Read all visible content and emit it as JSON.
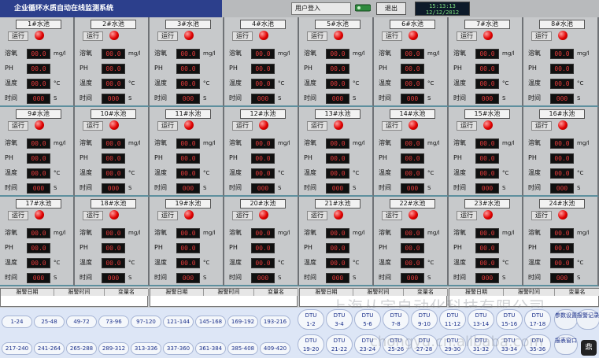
{
  "header": {
    "title": "企业循环水质自动在线监测系统",
    "login_label": "用户登入",
    "exit_label": "退出",
    "clock_time": "15:13:13",
    "clock_date": "12/12/2012"
  },
  "row_labels": {
    "run": "运行",
    "ammonia": "溶氧",
    "ph": "PH",
    "temp": "温度",
    "time": "时间",
    "unit_mgl": "mg/l",
    "unit_c": "°C",
    "unit_s": "S"
  },
  "panels": [
    {
      "title": "1#水池",
      "ammonia": "00.0",
      "ph": "00.0",
      "temp": "00.0",
      "time": "000"
    },
    {
      "title": "2#水池",
      "ammonia": "00.0",
      "ph": "00.0",
      "temp": "00.0",
      "time": "000"
    },
    {
      "title": "3#水池",
      "ammonia": "00.0",
      "ph": "00.0",
      "temp": "00.0",
      "time": "000"
    },
    {
      "title": "4#水池",
      "ammonia": "00.0",
      "ph": "00.0",
      "temp": "00.0",
      "time": "000"
    },
    {
      "title": "5#水池",
      "ammonia": "00.0",
      "ph": "00.0",
      "temp": "00.0",
      "time": "000"
    },
    {
      "title": "6#水池",
      "ammonia": "00.0",
      "ph": "00.0",
      "temp": "00.0",
      "time": "000"
    },
    {
      "title": "7#水池",
      "ammonia": "00.0",
      "ph": "00.0",
      "temp": "00.0",
      "time": "000"
    },
    {
      "title": "8#水池",
      "ammonia": "00.0",
      "ph": "00.0",
      "temp": "00.0",
      "time": "000"
    },
    {
      "title": "9#水池",
      "ammonia": "00.0",
      "ph": "00.0",
      "temp": "00.0",
      "time": "000"
    },
    {
      "title": "10#水池",
      "ammonia": "00.0",
      "ph": "00.0",
      "temp": "00.0",
      "time": "000"
    },
    {
      "title": "11#水池",
      "ammonia": "00.0",
      "ph": "00.0",
      "temp": "00.0",
      "time": "000"
    },
    {
      "title": "12#水池",
      "ammonia": "00.0",
      "ph": "00.0",
      "temp": "00.0",
      "time": "000"
    },
    {
      "title": "13#水池",
      "ammonia": "00.0",
      "ph": "00.0",
      "temp": "00.0",
      "time": "000"
    },
    {
      "title": "14#水池",
      "ammonia": "00.0",
      "ph": "00.0",
      "temp": "00.0",
      "time": "000"
    },
    {
      "title": "15#水池",
      "ammonia": "00.0",
      "ph": "00.0",
      "temp": "00.0",
      "time": "000"
    },
    {
      "title": "16#水池",
      "ammonia": "00.0",
      "ph": "00.0",
      "temp": "00.0",
      "time": "000"
    },
    {
      "title": "17#水池",
      "ammonia": "00.0",
      "ph": "00.0",
      "temp": "00.0",
      "time": "000"
    },
    {
      "title": "18#水池",
      "ammonia": "00.0",
      "ph": "00.0",
      "temp": "00.0",
      "time": "000"
    },
    {
      "title": "19#水池",
      "ammonia": "00.0",
      "ph": "00.0",
      "temp": "00.0",
      "time": "000"
    },
    {
      "title": "20#水池",
      "ammonia": "00.0",
      "ph": "00.0",
      "temp": "00.0",
      "time": "000"
    },
    {
      "title": "21#水池",
      "ammonia": "00.0",
      "ph": "00.0",
      "temp": "00.0",
      "time": "000"
    },
    {
      "title": "22#水池",
      "ammonia": "00.0",
      "ph": "00.0",
      "temp": "00.0",
      "time": "000"
    },
    {
      "title": "23#水池",
      "ammonia": "00.0",
      "ph": "00.0",
      "temp": "00.0",
      "time": "000"
    },
    {
      "title": "24#水池",
      "ammonia": "00.0",
      "ph": "00.0",
      "temp": "00.0",
      "time": "000"
    }
  ],
  "alarm_tables": [
    {
      "date": "报警日期",
      "time": "报警时间",
      "var": "变量名"
    },
    {
      "date": "报警日期",
      "time": "报警时间",
      "var": "变量名"
    },
    {
      "date": "报警日期",
      "time": "报警时间",
      "var": "变量名"
    },
    {
      "date": "报警日期",
      "time": "报警时间",
      "var": "变量名"
    }
  ],
  "ranges_top": [
    "1-24",
    "25-48",
    "49-72",
    "73-96",
    "97-120",
    "121-144",
    "145-168",
    "169-192",
    "193-216"
  ],
  "ranges_bottom": [
    "217-240",
    "241-264",
    "265-288",
    "289-312",
    "313-336",
    "337-360",
    "361-384",
    "385-408",
    "409-420"
  ],
  "dtu_top": [
    "DTU 1-2",
    "DTU 3-4",
    "DTU 5-6",
    "DTU 7-8",
    "DTU 9-10",
    "DTU 11-12",
    "DTU 13-14",
    "DTU 15-16",
    "DTU 17-18"
  ],
  "dtu_bottom": [
    "DTU 19-20",
    "DTU 21-22",
    "DTU 23-24",
    "DTU 25-26",
    "DTU 27-28",
    "DTU 29-30",
    "DTU 31-32",
    "DTU 33-34",
    "DTU 35-36"
  ],
  "side_buttons": [
    "参数设置",
    "报警记录",
    "报表窗口"
  ],
  "logo_text": "鼎",
  "watermark": "上海从宇自动化科技有限公司",
  "watermark2": "chongyu.cn.alibaba.com"
}
